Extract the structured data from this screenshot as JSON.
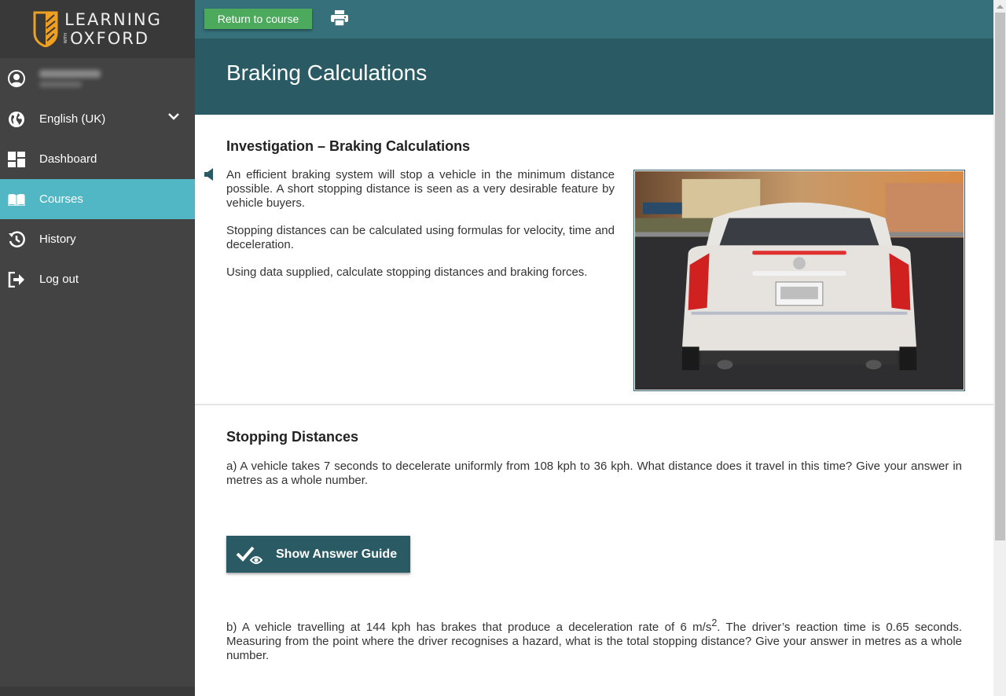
{
  "brand": {
    "line1": "LEARNING",
    "with": "WITH",
    "line2": "OXFORD",
    "accent_color": "#f0a020"
  },
  "user": {
    "name_blurred": true
  },
  "sidebar": {
    "language": {
      "label": "English (UK)",
      "icon": "globe-icon"
    },
    "items": [
      {
        "label": "Dashboard",
        "icon": "dashboard-icon",
        "active": false
      },
      {
        "label": "Courses",
        "icon": "book-icon",
        "active": true
      },
      {
        "label": "History",
        "icon": "history-icon",
        "active": false
      },
      {
        "label": "Log out",
        "icon": "logout-icon",
        "active": false
      }
    ],
    "active_color": "#52b7c5"
  },
  "toolbar": {
    "return_label": "Return to course",
    "print_icon": "print-icon"
  },
  "page": {
    "title": "Braking Calculations"
  },
  "investigation": {
    "heading": "Investigation – Braking Calculations",
    "paragraphs": [
      "An efficient braking system will stop a vehicle in the minimum distance possible. A short stopping distance is seen as a very desirable feature by vehicle buyers.",
      "Stopping distances can be calculated using formulas for velocity, time and deceleration.",
      "Using data supplied, calculate stopping distances and braking forces."
    ],
    "image_alt": "Rear view of a white car with red tail lights"
  },
  "stopping": {
    "heading": "Stopping Distances",
    "question_a": "a) A vehicle takes 7 seconds to decelerate uniformly from 108 kph to 36 kph. What distance does it travel in this time? Give your answer in metres as a whole number.",
    "answer_button": "Show Answer Guide",
    "question_b_pre": "b) A vehicle travelling at 144 kph has brakes that produce a deceleration rate of 6 m/s",
    "question_b_sup": "2",
    "question_b_post": ". The driver’s reaction time is 0.65 seconds. Measuring from the point where the driver recognises a hazard, what is the total stopping distance? Give your answer in metres as a whole number."
  }
}
